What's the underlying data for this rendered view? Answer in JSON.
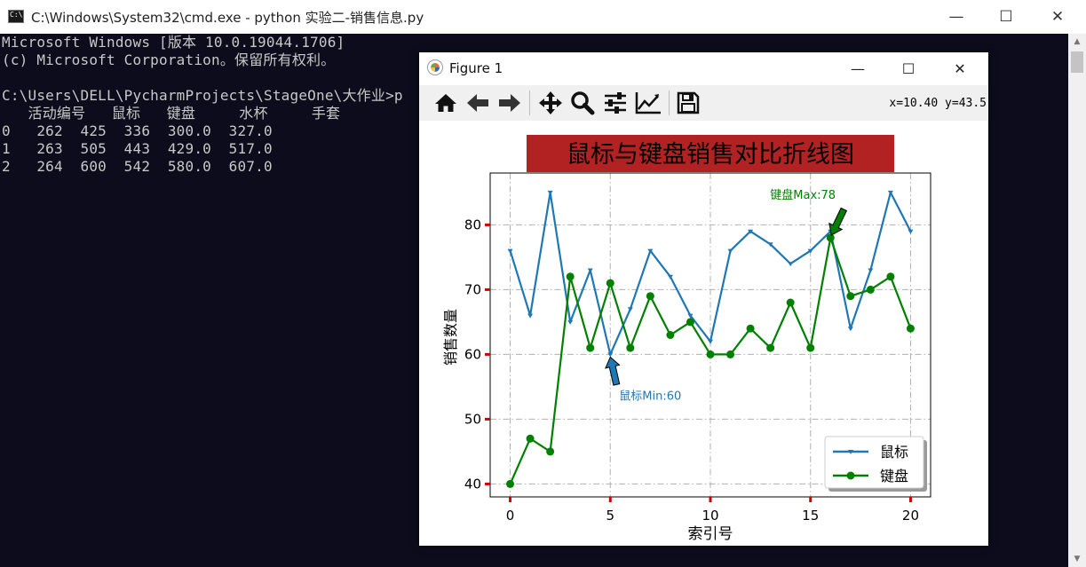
{
  "cmd": {
    "title": "C:\\Windows\\System32\\cmd.exe - python  实验二-销售信息.py",
    "icon": "cmd-icon",
    "minimize_glyph": "—",
    "maximize_glyph": "☐",
    "close_glyph": "✕",
    "lines": [
      "Microsoft Windows [版本 10.0.19044.1706]",
      "(c) Microsoft Corporation。保留所有权利。",
      "",
      "C:\\Users\\DELL\\PycharmProjects\\StageOne\\大作业>p",
      "   活动编号   鼠标   键盘     水杯     手套",
      "0   262  425  336  300.0  327.0",
      "1   263  505  443  429.0  517.0",
      "2   264  600  542  580.0  607.0"
    ],
    "colors": {
      "background": "#0c0c1c",
      "text": "#c8c8c8"
    }
  },
  "figure": {
    "title": "Figure 1",
    "minimize_glyph": "—",
    "maximize_glyph": "☐",
    "close_glyph": "✕",
    "toolbar": {
      "buttons": [
        "home-icon",
        "back-arrow-icon",
        "forward-arrow-icon",
        "pan-icon",
        "zoom-icon",
        "subplots-icon",
        "axes-edit-icon",
        "save-icon"
      ],
      "coord_readout": "x=10.40 y=43.5"
    }
  },
  "chart_data": {
    "type": "line",
    "title": "鼠标与键盘销售对比折线图",
    "title_bg_color": "#b22222",
    "xlabel": "索引号",
    "ylabel": "销售数量",
    "xlim": [
      -1,
      21
    ],
    "ylim": [
      38,
      88
    ],
    "xticks": [
      0,
      5,
      10,
      15,
      20
    ],
    "yticks": [
      40,
      50,
      60,
      70,
      80
    ],
    "tick_color": "#d00000",
    "grid": true,
    "grid_style": "dashdot",
    "legend_position": "lower-right",
    "x": [
      0,
      1,
      2,
      3,
      4,
      5,
      6,
      7,
      8,
      9,
      10,
      11,
      12,
      13,
      14,
      15,
      16,
      17,
      18,
      19,
      20
    ],
    "series": [
      {
        "name": "鼠标",
        "color": "#1f77b4",
        "marker": "tri-down",
        "values": [
          76,
          66,
          85,
          65,
          73,
          60,
          67,
          76,
          72,
          66,
          62,
          76,
          79,
          77,
          74,
          76,
          79,
          64,
          73,
          85,
          79
        ]
      },
      {
        "name": "键盘",
        "color": "#008000",
        "marker": "circle",
        "values": [
          40,
          47,
          45,
          72,
          61,
          71,
          61,
          69,
          63,
          65,
          60,
          60,
          64,
          61,
          68,
          61,
          78,
          69,
          70,
          72,
          64
        ]
      }
    ],
    "annotations": [
      {
        "text": "鼠标Min:60",
        "x": 5,
        "y": 60,
        "color": "#1f77b4"
      },
      {
        "text": "键盘Max:78",
        "x": 16,
        "y": 78,
        "color": "#008000"
      }
    ]
  }
}
